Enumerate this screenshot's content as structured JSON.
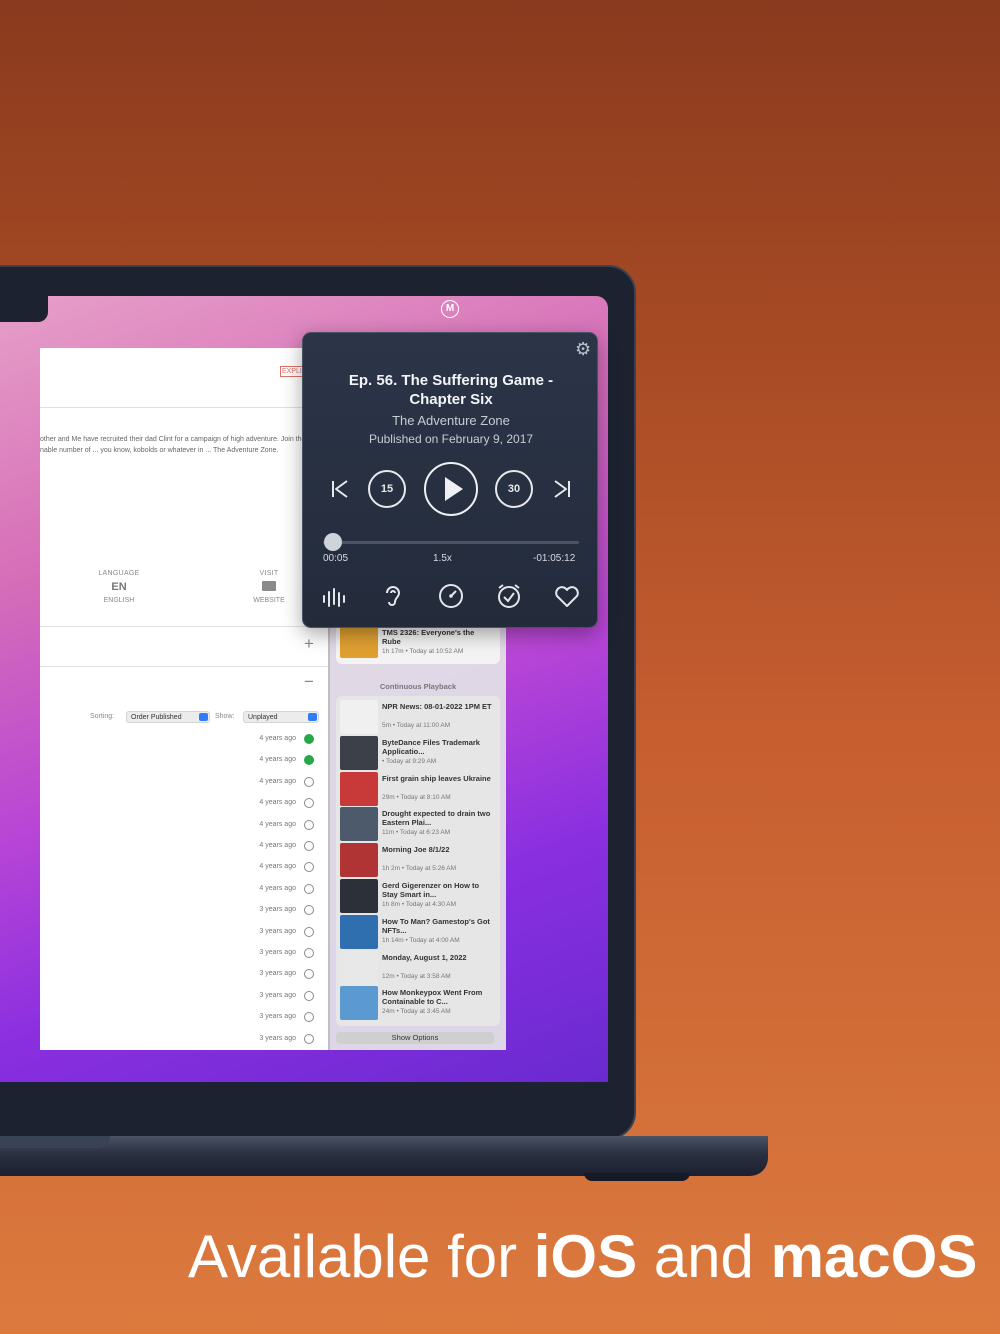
{
  "background_window": {
    "explicit_badge": "EXPLI",
    "description_line1": "other and Me have recruited their dad Clint for a campaign of high adventure. Join the",
    "description_line2": "nable number of ... you know, kobolds or whatever in ... The Adventure Zone.",
    "language": {
      "caption": "LANGUAGE",
      "value": "EN",
      "sub": "ENGLISH"
    },
    "visit": {
      "caption": "VISIT",
      "sub": "WEBSITE"
    },
    "sorting_label": "Sorting:",
    "sorting_value": "Order Published",
    "show_label": "Show:",
    "show_value": "Unplayed",
    "episodes": [
      {
        "age": "4 years ago",
        "status": "played"
      },
      {
        "age": "4 years ago",
        "status": "played"
      },
      {
        "age": "4 years ago",
        "status": "download"
      },
      {
        "age": "4 years ago",
        "status": "download"
      },
      {
        "age": "4 years ago",
        "status": "download"
      },
      {
        "age": "4 years ago",
        "status": "download"
      },
      {
        "age": "4 years ago",
        "status": "download"
      },
      {
        "age": "4 years ago",
        "status": "download"
      },
      {
        "age": "3 years ago",
        "status": "download"
      },
      {
        "age": "3 years ago",
        "status": "download"
      },
      {
        "age": "3 years ago",
        "status": "download"
      },
      {
        "age": "3 years ago",
        "status": "download"
      },
      {
        "age": "3 years ago",
        "status": "download"
      },
      {
        "age": "3 years ago",
        "status": "download"
      },
      {
        "age": "3 years ago",
        "status": "download"
      }
    ]
  },
  "queue": {
    "up_next": {
      "title": "TMS 2326: Everyone's the Rube",
      "meta": "1h 17m  •  Today at 10:52 AM",
      "color": "#e0a030"
    },
    "section_title": "Continuous Playback",
    "items": [
      {
        "title": "NPR News: 08-01-2022 1PM ET",
        "meta": "5m  •  Today at 11:00 AM",
        "color": "#f0f0f0"
      },
      {
        "title": "ByteDance Files Trademark Applicatio...",
        "meta": "•  Today at 9:29 AM",
        "color": "#3c4048"
      },
      {
        "title": "First grain ship leaves Ukraine",
        "meta": "29m  •  Today at 8:10 AM",
        "color": "#c83a3a"
      },
      {
        "title": "Drought expected to drain two Eastern Plai...",
        "meta": "11m  •  Today at 6:23 AM",
        "color": "#4c5a6c"
      },
      {
        "title": "Morning Joe 8/1/22",
        "meta": "1h 2m  •  Today at 5:26 AM",
        "color": "#b03434"
      },
      {
        "title": "Gerd Gigerenzer on How to Stay Smart in...",
        "meta": "1h 8m  •  Today at 4:30 AM",
        "color": "#2c3038"
      },
      {
        "title": "How To Man? Gamestop's Got NFTs...",
        "meta": "1h 14m  •  Today at 4:00 AM",
        "color": "#2f6fb0"
      },
      {
        "title": "Monday, August 1, 2022",
        "meta": "12m  •  Today at 3:58 AM",
        "color": "#e8e8e8"
      },
      {
        "title": "How Monkeypox Went From Containable to C...",
        "meta": "24m  •  Today at 3:45 AM",
        "color": "#5a9ad0"
      }
    ],
    "show_options": "Show Options"
  },
  "now_playing": {
    "menu_icon": "M",
    "title": "Ep. 56. The Suffering Game - Chapter Six",
    "show": "The Adventure Zone",
    "published": "Published on February 9, 2017",
    "skip_back": "15",
    "skip_forward": "30",
    "elapsed": "00:05",
    "speed": "1.5x",
    "remaining": "-01:05:12",
    "progress": 0.01
  },
  "tagline": {
    "part1": "Available for ",
    "part2": "iOS",
    "part3": " and ",
    "part4": "macOS"
  },
  "icons": [
    "gear-icon",
    "previous-track-icon",
    "skip-back-icon",
    "play-icon",
    "skip-forward-icon",
    "next-track-icon",
    "voice-boost-icon",
    "hearing-icon",
    "speed-icon",
    "sleep-timer-icon",
    "favorite-heart-icon"
  ]
}
